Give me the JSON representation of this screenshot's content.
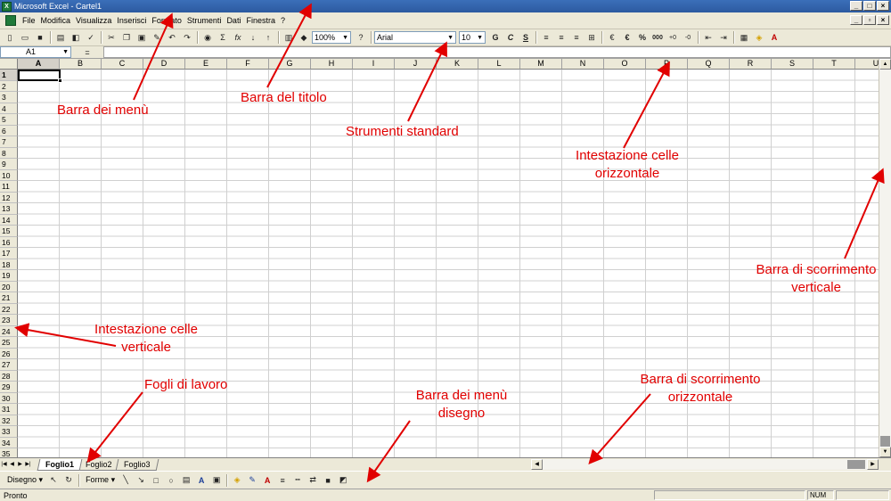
{
  "window": {
    "title": "Microsoft Excel - Cartel1"
  },
  "menu": {
    "items": [
      "File",
      "Modifica",
      "Visualizza",
      "Inserisci",
      "Formato",
      "Strumenti",
      "Dati",
      "Finestra",
      "?"
    ]
  },
  "toolbar": {
    "zoom": "100%",
    "font_name": "Arial",
    "font_size": "10",
    "bold_label": "G",
    "italic_label": "C",
    "underline_label": "S",
    "currency_label": "€",
    "percent_label": "%",
    "thousands_label": "000",
    "sum_label": "Σ",
    "fx_label": "fx"
  },
  "formula_bar": {
    "cell_ref": "A1",
    "equals": "=",
    "value": ""
  },
  "grid": {
    "columns": [
      "A",
      "B",
      "C",
      "D",
      "E",
      "F",
      "G",
      "H",
      "I",
      "J",
      "K",
      "L",
      "M",
      "N",
      "O",
      "P",
      "Q",
      "R",
      "S",
      "T",
      "U"
    ],
    "rows": [
      "1",
      "2",
      "3",
      "4",
      "5",
      "6",
      "7",
      "8",
      "9",
      "10",
      "11",
      "12",
      "13",
      "14",
      "15",
      "16",
      "17",
      "18",
      "19",
      "20",
      "21",
      "22",
      "23",
      "24",
      "25",
      "26",
      "27",
      "28",
      "29",
      "30",
      "31",
      "32",
      "33",
      "34",
      "35"
    ],
    "active_cell": "A1"
  },
  "sheets": {
    "tabs": [
      "Foglio1",
      "Foglio2",
      "Foglio3"
    ],
    "active": "Foglio1"
  },
  "drawing_toolbar": {
    "draw_menu": "Disegno",
    "shapes_menu": "Forme"
  },
  "status": {
    "text": "Pronto",
    "num": "NUM"
  },
  "annotations": {
    "menu_bar": "Barra dei menù",
    "title_bar": "Barra del titolo",
    "standard_tools": "Strumenti standard",
    "col_header_1": "Intestazione celle",
    "col_header_2": "orizzontale",
    "row_header_1": "Intestazione celle",
    "row_header_2": "verticale",
    "vscroll_1": "Barra di scorrimento",
    "vscroll_2": "verticale",
    "sheets": "Fogli di lavoro",
    "draw_bar_1": "Barra dei menù",
    "draw_bar_2": "disegno",
    "hscroll_1": "Barra di scorrimento",
    "hscroll_2": "orizzontale"
  },
  "colors": {
    "annotation": "#e10000",
    "titlebar": "#2c5aa0",
    "chrome": "#ece9d8"
  }
}
